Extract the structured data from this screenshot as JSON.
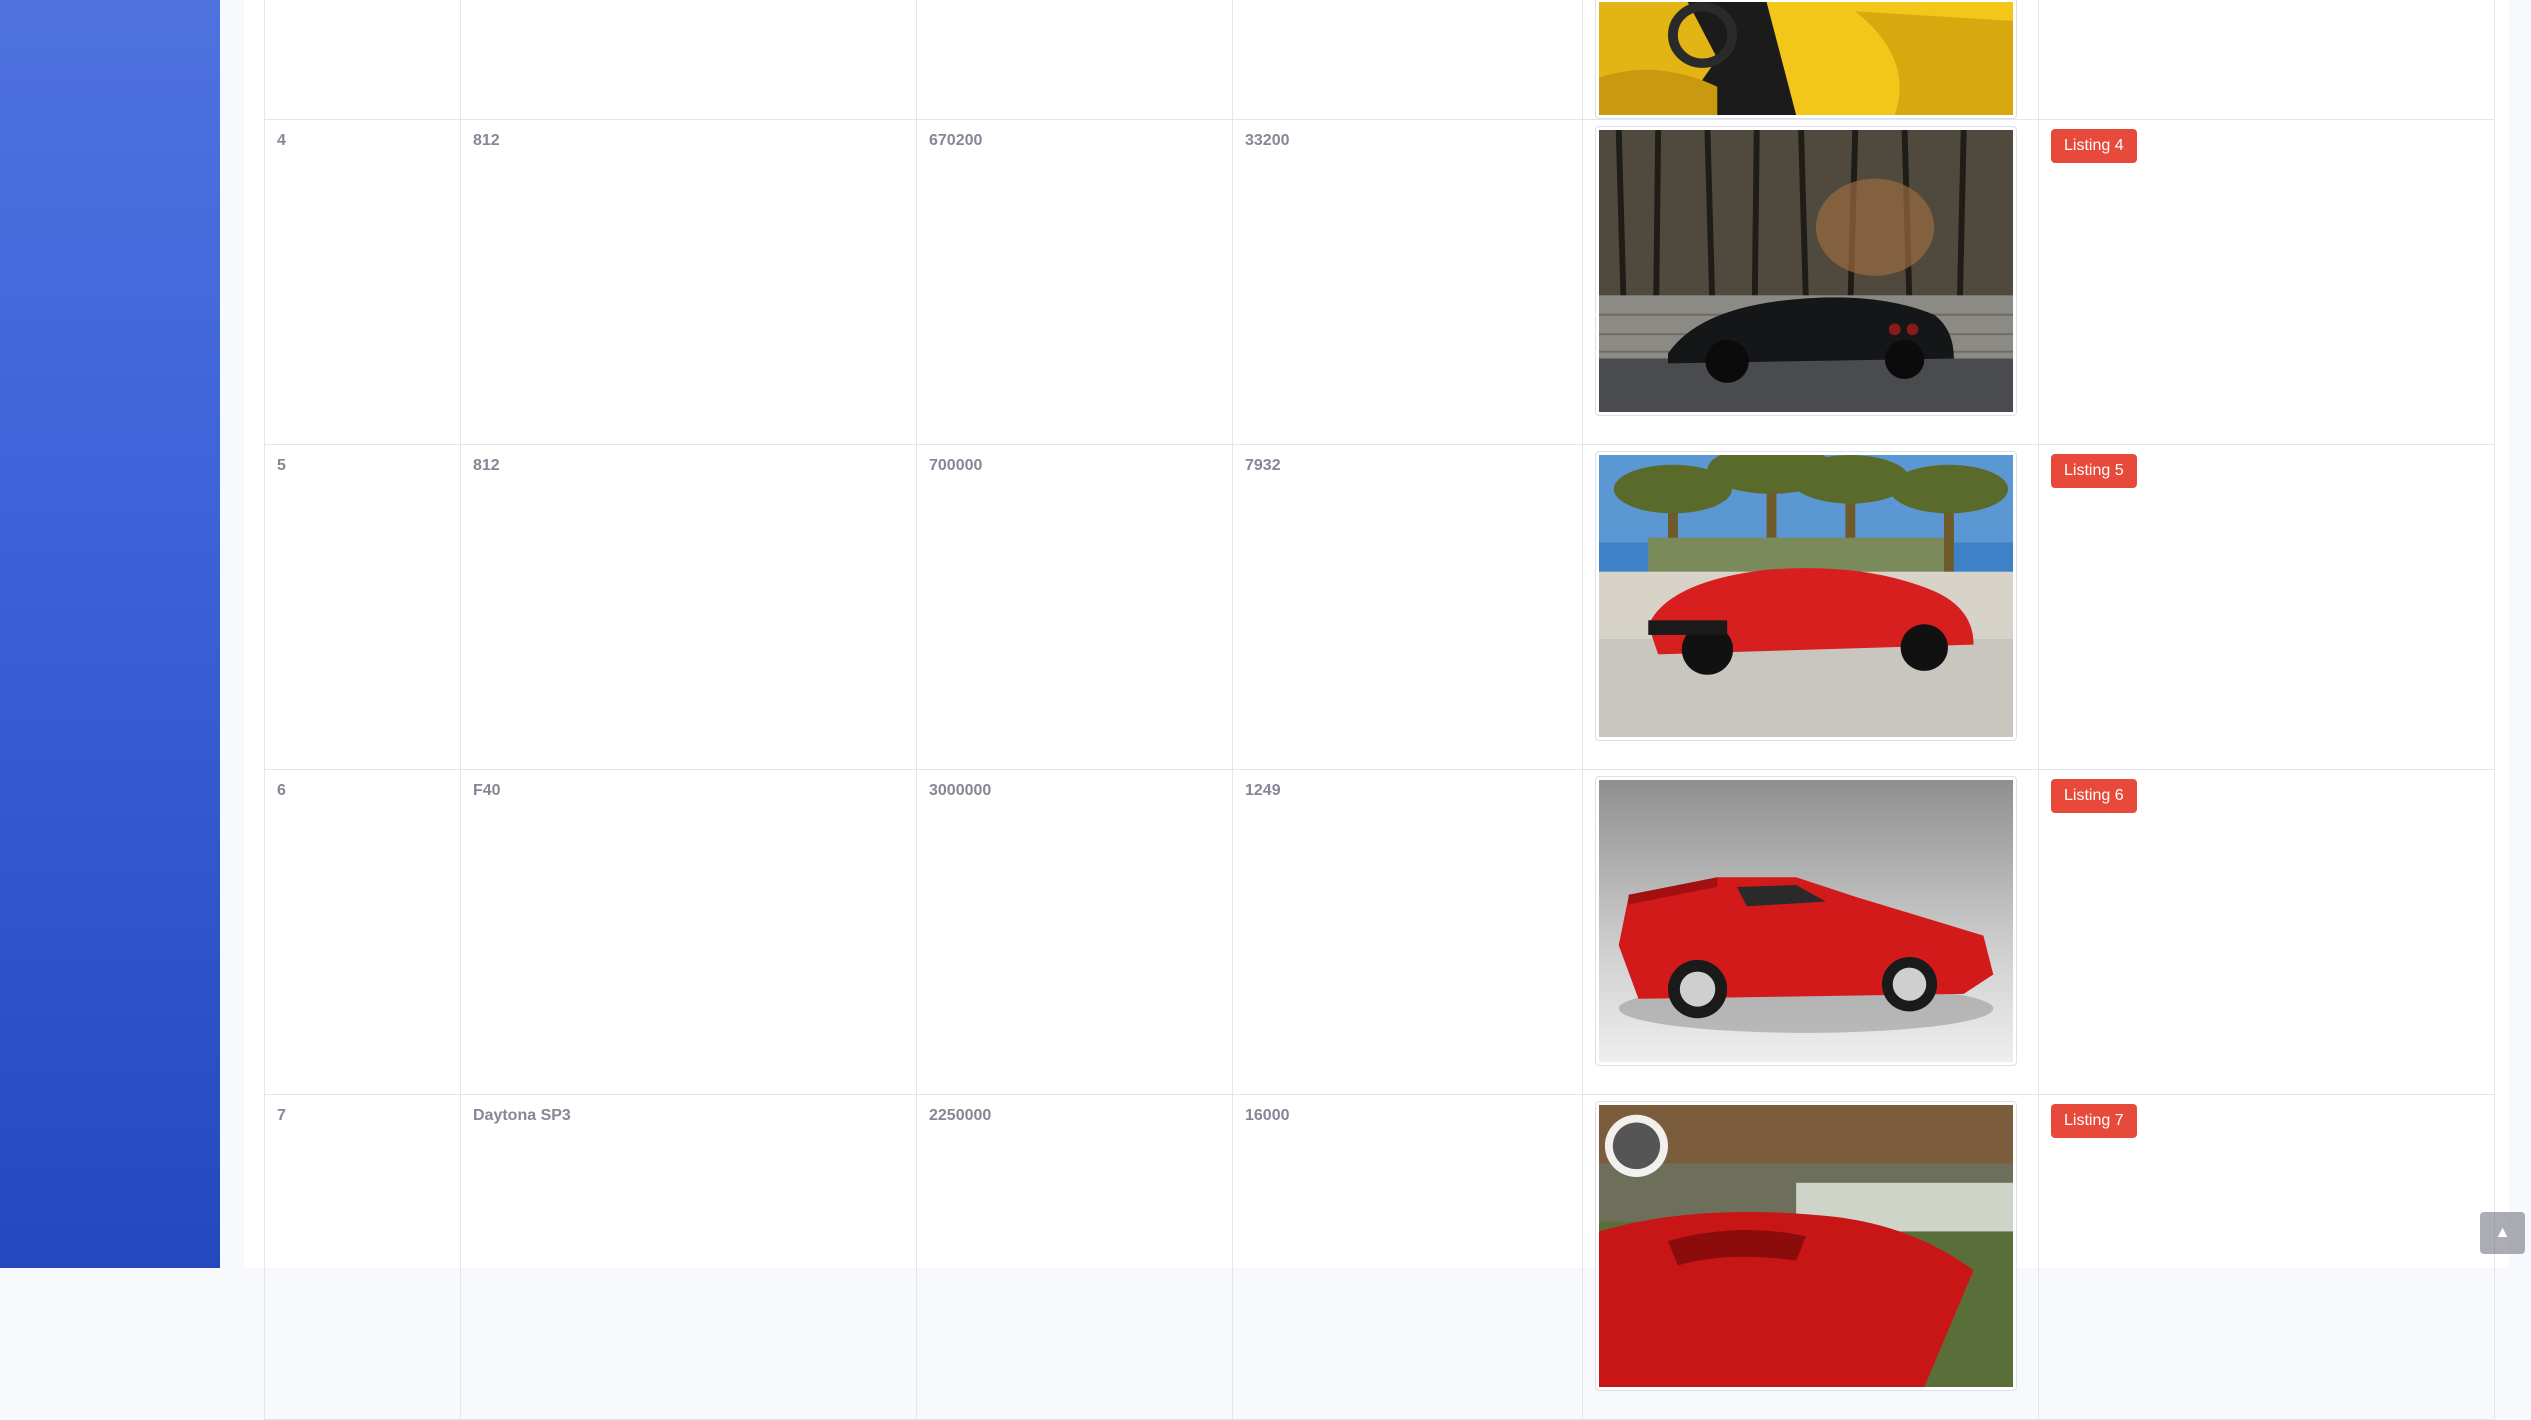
{
  "rows": [
    {
      "id": "4",
      "model": "812",
      "price": "670200",
      "mileage": "33200",
      "image": "black ferrari 812 in forest",
      "button": "Listing 4"
    },
    {
      "id": "5",
      "model": "812",
      "price": "700000",
      "mileage": "7932",
      "image": "red ferrari 812 under palm trees",
      "button": "Listing 5"
    },
    {
      "id": "6",
      "model": "F40",
      "price": "3000000",
      "mileage": "1249",
      "image": "red ferrari f40 studio",
      "button": "Listing 6"
    },
    {
      "id": "7",
      "model": "Daytona SP3",
      "price": "2250000",
      "mileage": "16000",
      "image": "red ferrari daytona sp3 on track",
      "button": "Listing 7"
    }
  ],
  "icons": {
    "scroll_top": "chevron-up-icon"
  },
  "colors": {
    "sidebar": "#4e73df",
    "button": "#e74a3b"
  }
}
